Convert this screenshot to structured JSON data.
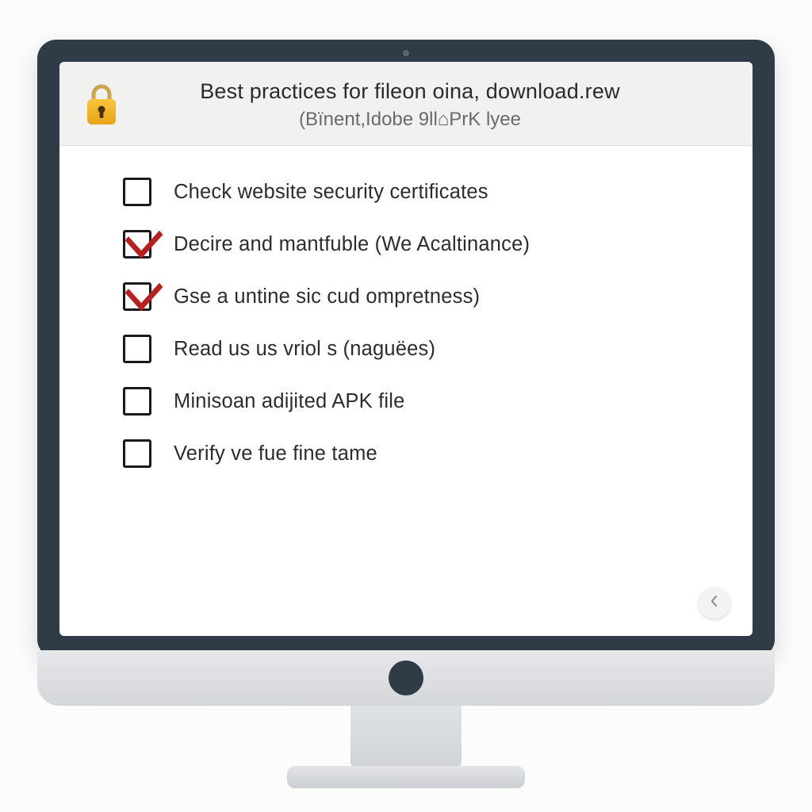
{
  "header": {
    "title": "Best practices for fileon oina, download.rew",
    "subtitle": "(Bïnent,Idobe 9ll⌂PrK lyee"
  },
  "icons": {
    "lock": "lock-icon",
    "chevron_left": "chevron-left-icon"
  },
  "colors": {
    "bezel": "#2f3b47",
    "header_bg": "#f1f1f0",
    "check_mark": "#b81f1f",
    "lock_body": "#f5b92b",
    "lock_shade": "#e09a12"
  },
  "checklist": [
    {
      "label": "Check website security certificates",
      "checked": false
    },
    {
      "label": "Decire and mantfuble (We Acaltinance)",
      "checked": true
    },
    {
      "label": "Gse a untine sic cud ompretness)",
      "checked": true
    },
    {
      "label": "Read us us vriol s (naguëes)",
      "checked": false
    },
    {
      "label": "Minisoan adijited APK file",
      "checked": false
    },
    {
      "label": "Verify ve fue fine tame",
      "checked": false
    }
  ],
  "nav": {
    "back_tooltip": "Back"
  }
}
